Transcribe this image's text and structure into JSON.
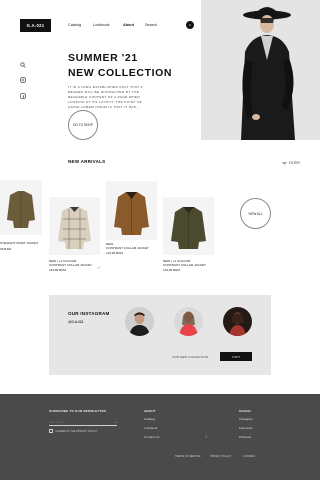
{
  "header": {
    "logo": "G.A.021",
    "nav": [
      "Catalog",
      "Lookbook",
      "About",
      "Search"
    ],
    "cart_count": "0"
  },
  "hero": {
    "title_line1": "SUMMER '21",
    "title_line2": "NEW COLLECTION",
    "blurb": "IT IS A LONG ESTABLISHED FACT THAT A READER WILL BE DISTRACTED BY THE READABLE CONTENT OF A PAGE WHEN LOOKING AT ITS LAYOUT. THE POINT OF USING LOREM IPSUM IS THAT IT HAS...",
    "cta": "GO TO SHOP"
  },
  "sidebar": {
    "icons": [
      "search-icon",
      "instagram-icon",
      "facebook-icon"
    ]
  },
  "arrivals": {
    "title": "NEW ARRIVALS",
    "filter": "FILTER",
    "view_all": "VIEW ALL",
    "products": [
      {
        "label": "STRAIGHT PRINT JACKET",
        "price": "25 BAM",
        "color": "#6b5d3a"
      },
      {
        "label": "NEW | +1 COLOUR\nCONTRAST COLLAR JACKET",
        "price": "119,99 BAM",
        "color": "#d8cfbf"
      },
      {
        "label": "NEW\nCONTRAST COLLAR JACKET",
        "price": "119,99 BAM",
        "color": "#8a5a2b"
      },
      {
        "label": "NEW | +1 COLOUR\nCONTRAST COLLAR JACKET",
        "price": "119,99 BAM",
        "color": "#4b4a2e"
      }
    ]
  },
  "instagram": {
    "title": "OUR INSTAGRAM",
    "handle": "@G.A.021",
    "promo": "JOIN NEW COLLECTION",
    "visit": "VISIT"
  },
  "footer": {
    "newsletter_title": "SUBSCRIBE TO OUR NEWSLETTER",
    "email_placeholder": "Your e-mail",
    "consent": "I AGREE TO THE PRIVACY POLICY",
    "about_title": "ABOUT",
    "about_links": [
      "Catalog",
      "Lookbook",
      "Contact Us"
    ],
    "social_title": "SOCIAL",
    "social_links": [
      "Instagram",
      "Facebook",
      "Pinterest"
    ],
    "bottom_links": [
      "TERMS OF SERVICE",
      "PRIVACY POLICY",
      "COOKIES"
    ]
  }
}
